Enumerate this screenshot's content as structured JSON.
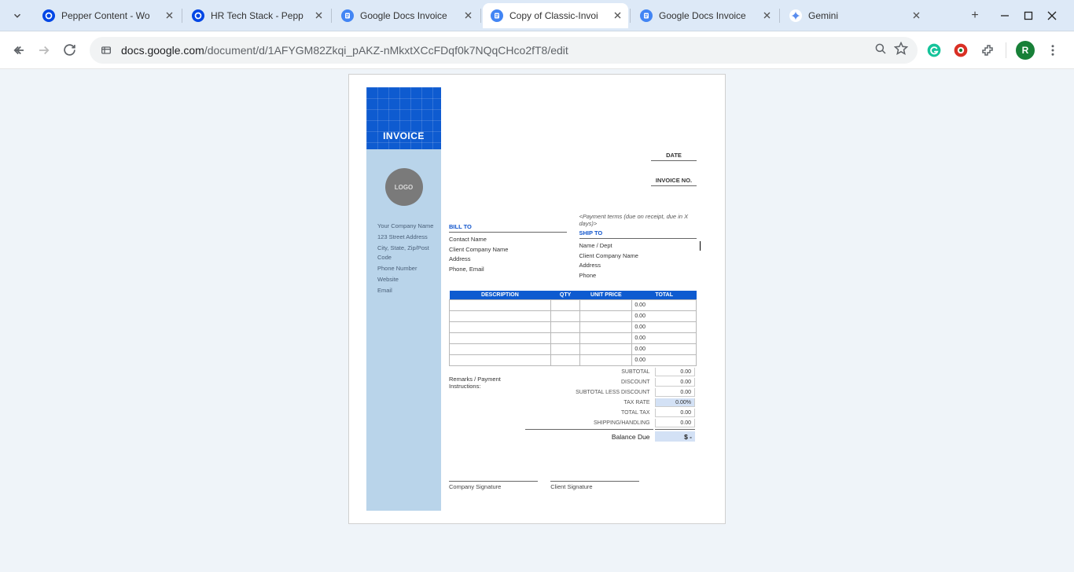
{
  "tabs": [
    {
      "title": "Pepper Content - Wo",
      "type": "pepper"
    },
    {
      "title": "HR Tech Stack - Pepp",
      "type": "pepper"
    },
    {
      "title": "Google Docs Invoice",
      "type": "gdoc"
    },
    {
      "title": "Copy of Classic-Invoi",
      "type": "gdoc",
      "active": true
    },
    {
      "title": "Google Docs Invoice",
      "type": "gdoc"
    },
    {
      "title": "Gemini",
      "type": "gemini"
    }
  ],
  "url_host": "docs.google.com",
  "url_path": "/document/d/1AFYGM82Zkqi_pAKZ-nMkxtXCcFDqf0k7NQqCHco2fT8/edit",
  "profile_initial": "R",
  "doc": {
    "header": "INVOICE",
    "logo_text": "LOGO",
    "company": {
      "name": "Your Company Name",
      "addr": "123 Street Address",
      "city": "City, State, Zip/Post Code",
      "phone": "Phone Number",
      "website": "Website",
      "email": "Email"
    },
    "date_label": "DATE",
    "invoice_no_label": "INVOICE NO.",
    "bill_to": {
      "hdr": "BILL TO",
      "contact": "Contact Name",
      "company": "Client Company Name",
      "address": "Address",
      "phone_email": "Phone, Email"
    },
    "ship_to": {
      "hint": "<Payment terms (due on receipt, due in X days)>",
      "hdr": "SHIP TO",
      "name": "Name / Dept",
      "company": "Client Company Name",
      "address": "Address",
      "phone": "Phone"
    },
    "columns": {
      "desc": "DESCRIPTION",
      "qty": "QTY",
      "unit": "UNIT PRICE",
      "total": "TOTAL"
    },
    "line_total": "0.00",
    "totals": {
      "subtotal_l": "SUBTOTAL",
      "subtotal_v": "0.00",
      "discount_l": "DISCOUNT",
      "discount_v": "0.00",
      "stless_l": "SUBTOTAL LESS DISCOUNT",
      "stless_v": "0.00",
      "taxrate_l": "TAX RATE",
      "taxrate_v": "0.00%",
      "totaltax_l": "TOTAL TAX",
      "totaltax_v": "0.00",
      "ship_l": "SHIPPING/HANDLING",
      "ship_v": "0.00",
      "due_l": "Balance Due",
      "due_v": "$ -"
    },
    "remarks_label": "Remarks / Payment Instructions:",
    "sign_company": "Company Signature",
    "sign_client": "Client Signature"
  }
}
